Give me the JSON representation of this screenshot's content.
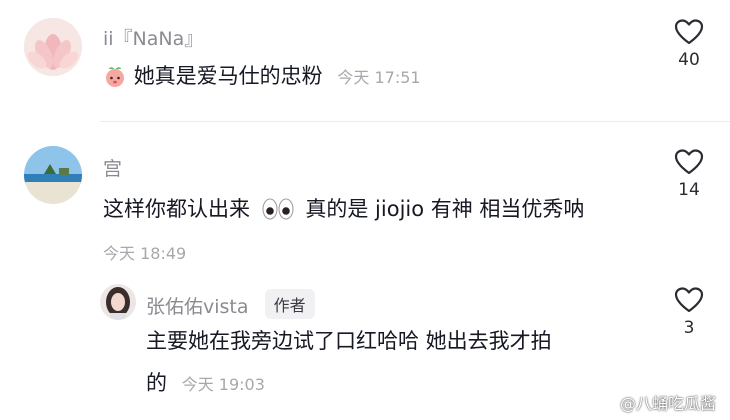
{
  "comments": [
    {
      "username": "ii『NaNa』",
      "text": "她真是爱马仕的忠粉",
      "time": "今天 17:51",
      "likes": "40",
      "emoji": "peach-face-emoji"
    },
    {
      "username": "宫",
      "text_part1": "这样你都认出来",
      "text_part2": "真的是 jiojio 有神 相当优秀呐",
      "time": "今天 18:49",
      "likes": "14",
      "emoji": "eyes-emoji"
    }
  ],
  "reply": {
    "username": "张佑佑vista",
    "badge": "作者",
    "line1": "主要她在我旁边试了口红哈哈 她出去我才拍",
    "line2": "的",
    "time": "今天 19:03",
    "likes": "3"
  },
  "watermark": "@八蛹吃瓜酱",
  "colors": {
    "name": "#8a8b91",
    "text": "#161823",
    "time": "#a7a8ad",
    "badge_bg": "#f1f1f3"
  }
}
